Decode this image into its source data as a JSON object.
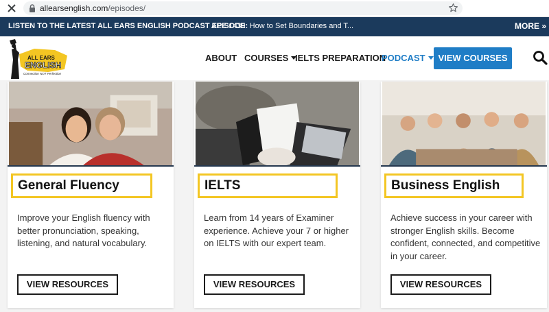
{
  "browser": {
    "url_domain": "allearsenglish.com",
    "url_path": "/episodes/",
    "close_icon": "close-icon",
    "lock_icon": "lock-icon",
    "star_icon": "star-icon"
  },
  "announcement": {
    "label": "LISTEN TO THE LATEST ALL EARS ENGLISH PODCAST EPISODE:",
    "episode": "AEE 1439: How to Set Boundaries and T...",
    "more": "MORE »",
    "background": "#1b3a5c"
  },
  "header": {
    "logo": {
      "line1": "ALL EARS",
      "line2": "ENGLISH",
      "tagline": "Connection NOT Perfection"
    },
    "nav": {
      "about": "ABOUT",
      "courses": "COURSES",
      "ielts": "IELTS PREPARATION",
      "podcast": "PODCAST"
    },
    "view_courses": "VIEW COURSES",
    "search_icon": "search-icon",
    "accent": "#1f7dc6"
  },
  "cards": [
    {
      "title": "General Fluency",
      "description": "Improve your English fluency with better pronunciation, speaking, listening, and natural vocabulary.",
      "button": "VIEW RESOURCES"
    },
    {
      "title": "IELTS",
      "description": "Learn from 14 years of Examiner experience. Achieve your 7 or higher on IELTS with our expert team.",
      "button": "VIEW RESOURCES"
    },
    {
      "title": "Business English",
      "description": "Achieve success in your career with stronger English skills. Become confident, connected, and competitive in your career.",
      "button": "VIEW RESOURCES"
    }
  ],
  "highlight_color": "#f3c623"
}
